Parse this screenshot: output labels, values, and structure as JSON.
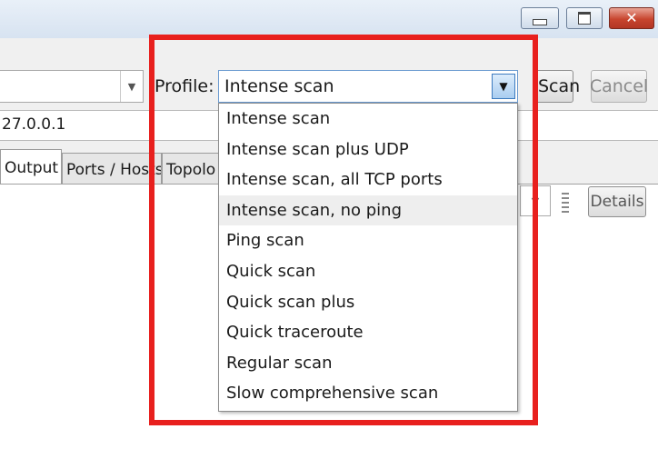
{
  "window": {
    "minimize_glyph": "",
    "maximize_glyph": "",
    "close_glyph": "✕",
    "close_color": "#c8452f"
  },
  "toolbar": {
    "target_value": "",
    "profile_label": "Profile:",
    "profile_value": "Intense scan",
    "scan_label": "Scan",
    "cancel_label": "Cancel"
  },
  "command": {
    "value": "27.0.0.1"
  },
  "tabs": [
    {
      "label": "Output"
    },
    {
      "label": "Ports / Hosts"
    },
    {
      "label": "Topolo"
    }
  ],
  "results": {
    "details_label": "Details"
  },
  "dropdown": {
    "options": [
      "Intense scan",
      "Intense scan plus UDP",
      "Intense scan, all TCP ports",
      "Intense scan, no ping",
      "Ping scan",
      "Quick scan",
      "Quick scan plus",
      "Quick traceroute",
      "Regular scan",
      "Slow comprehensive scan"
    ],
    "hovered_option": "Intense scan, no ping"
  },
  "annotation": {
    "highlight_color": "#e8201e"
  },
  "icons": {
    "combo_arrow": "chevron-down-icon"
  }
}
